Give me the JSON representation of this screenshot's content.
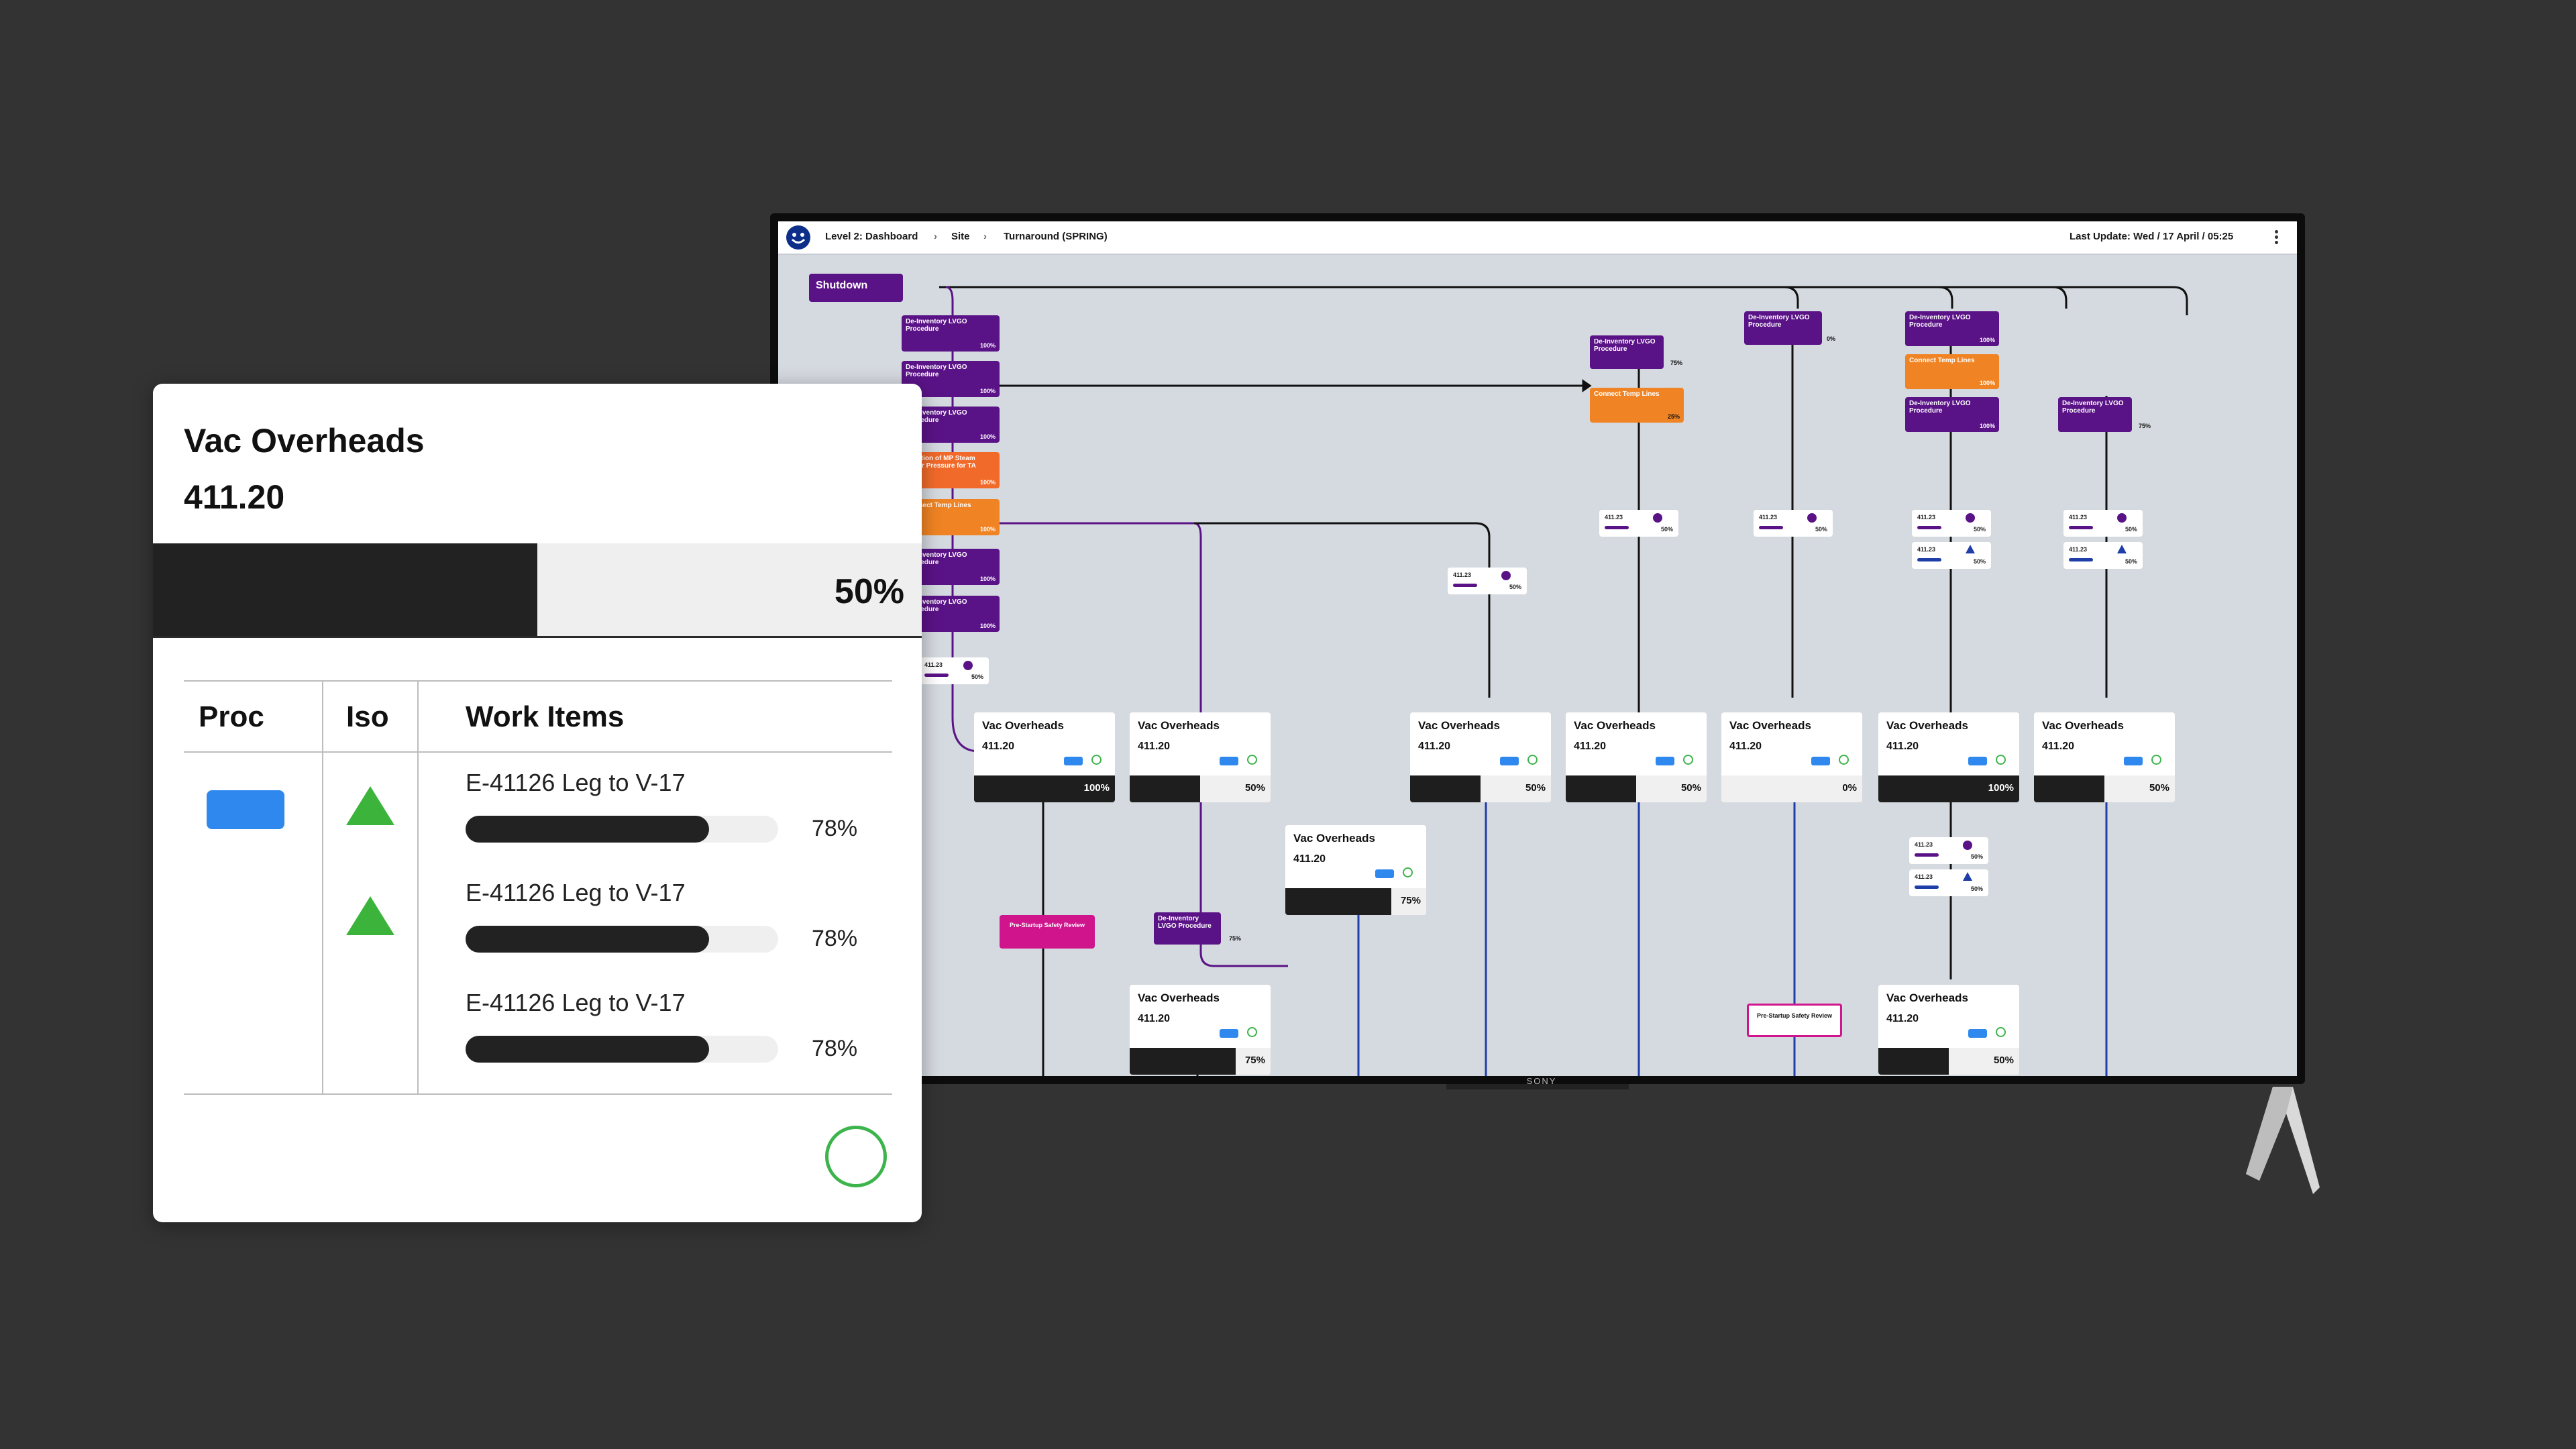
{
  "dashboard": {
    "breadcrumb": [
      "Level 2: Dashboard",
      "Site",
      "Turnaround (SPRING)"
    ],
    "last_update": "Last Update: Wed / 17 April / 05:25",
    "shutdown_label": "Shutdown",
    "brand": "SONY",
    "procedure_label": "De-inventory LVGO Procedure",
    "temp_lines_label": "Connect Temp Lines",
    "isolation_label": "Isolation of MP Steam Vapor Pressure for TA",
    "psr_label": "Pre-Startup Safety Review",
    "mini_code": "411.23",
    "colors": {
      "purple": "#5a1387",
      "orange": "#f08424",
      "magenta": "#d0148c",
      "blue": "#2e88ee",
      "green": "#3cb44b"
    }
  },
  "left_chips": [
    {
      "label": "De-Inventory LVGO Procedure",
      "pct": "100%",
      "color": "purple"
    },
    {
      "label": "De-Inventory LVGO Procedure",
      "pct": "100%",
      "color": "purple"
    },
    {
      "label": "De-Inventory LVGO Procedure",
      "pct": "100%",
      "color": "purple"
    },
    {
      "label": "Isolation of MP Steam Vapor Pressure for TA",
      "pct": "100%",
      "color": "orange"
    },
    {
      "label": "Connect Temp Lines",
      "pct": "100%",
      "color": "orange"
    },
    {
      "label": "De-Inventory LVGO Procedure",
      "pct": "100%",
      "color": "purple"
    },
    {
      "label": "De-Inventory LVGO Procedure",
      "pct": "100%",
      "color": "purple"
    }
  ],
  "top_chips": [
    {
      "label": "De-Inventory LVGO Procedure",
      "pct": "75%",
      "color": "purple"
    },
    {
      "label": "Connect Temp Lines",
      "pct": "25%",
      "color": "orange"
    },
    {
      "label": "De-Inventory LVGO Procedure",
      "pct": "0%",
      "color": "purple"
    },
    {
      "label": "De-Inventory LVGO Procedure",
      "pct": "100%",
      "color": "purple"
    },
    {
      "label": "Connect Temp Lines",
      "pct": "100%",
      "color": "orange"
    },
    {
      "label": "De-Inventory LVGO Procedure",
      "pct": "100%",
      "color": "purple"
    },
    {
      "label": "De-Inventory LVGO Procedure",
      "pct": "75%",
      "color": "purple"
    },
    {
      "label": "De-Inventory LVGO Procedure",
      "pct": "75%",
      "color": "purple"
    }
  ],
  "minis": [
    {
      "code": "411.23",
      "pct": "50%",
      "icon": "circle"
    },
    {
      "code": "411.23",
      "pct": "50%",
      "icon": "circle"
    },
    {
      "code": "411.23",
      "pct": "50%",
      "icon": "circle"
    },
    {
      "code": "411.23",
      "pct": "50%",
      "icon": "circle"
    },
    {
      "code": "411.23",
      "pct": "50%",
      "icon": "circle"
    },
    {
      "code": "411.23",
      "pct": "50%",
      "icon": "triangle"
    },
    {
      "code": "411.23",
      "pct": "50%",
      "icon": "circle"
    },
    {
      "code": "411.23",
      "pct": "50%",
      "icon": "triangle"
    },
    {
      "code": "411.23",
      "pct": "50%",
      "icon": "circle"
    },
    {
      "code": "411.23",
      "pct": "50%",
      "icon": "triangle"
    }
  ],
  "vac_cards": [
    {
      "name": "Vac Overheads",
      "code": "411.20",
      "pct": "100%",
      "progress": 1.0
    },
    {
      "name": "Vac Overheads",
      "code": "411.20",
      "pct": "50%",
      "progress": 0.5
    },
    {
      "name": "Vac Overheads",
      "code": "411.20",
      "pct": "50%",
      "progress": 0.5
    },
    {
      "name": "Vac Overheads",
      "code": "411.20",
      "pct": "50%",
      "progress": 0.5
    },
    {
      "name": "Vac Overheads",
      "code": "411.20",
      "pct": "0%",
      "progress": 0.0
    },
    {
      "name": "Vac Overheads",
      "code": "411.20",
      "pct": "100%",
      "progress": 1.0
    },
    {
      "name": "Vac Overheads",
      "code": "411.20",
      "pct": "50%",
      "progress": 0.5
    },
    {
      "name": "Vac Overheads",
      "code": "411.20",
      "pct": "75%",
      "progress": 0.75
    },
    {
      "name": "Vac Overheads",
      "code": "411.20",
      "pct": "75%",
      "progress": 0.75
    },
    {
      "name": "Vac Overheads",
      "code": "411.20",
      "pct": "50%",
      "progress": 0.5
    }
  ],
  "detail": {
    "title": "Vac Overheads",
    "code": "411.20",
    "progress_pct": "50%",
    "progress": 0.5,
    "headers": {
      "proc": "Proc",
      "iso": "Iso",
      "work_items": "Work Items"
    },
    "proc_status": "blue-rect",
    "iso_status": [
      "green-triangle",
      "green-triangle"
    ],
    "work_items": [
      {
        "name": "E-41126 Leg to V-17",
        "pct": "78%",
        "progress": 0.78
      },
      {
        "name": "E-41126 Leg to V-17",
        "pct": "78%",
        "progress": 0.78
      },
      {
        "name": "E-41126 Leg to V-17",
        "pct": "78%",
        "progress": 0.78
      }
    ],
    "status_icon": "circle-ok-icon"
  }
}
